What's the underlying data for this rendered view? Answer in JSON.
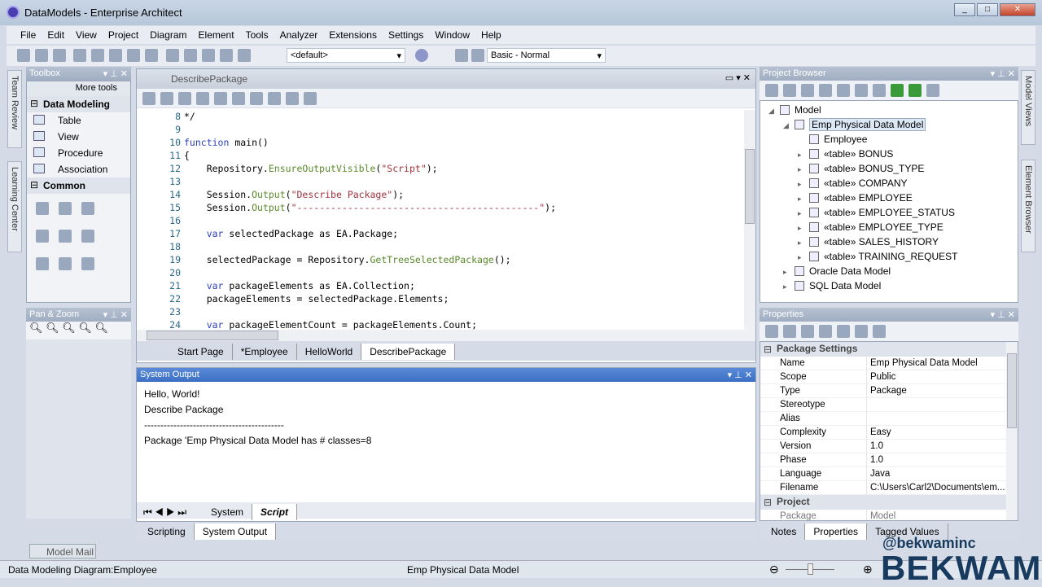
{
  "window": {
    "title": "DataModels - Enterprise Architect",
    "controls": [
      "_",
      "□",
      "✕"
    ]
  },
  "menu": [
    "File",
    "Edit",
    "View",
    "Project",
    "Diagram",
    "Element",
    "Tools",
    "Analyzer",
    "Extensions",
    "Settings",
    "Window",
    "Help"
  ],
  "toolbar": {
    "perspective": "<default>",
    "workspace": "Basic - Normal"
  },
  "side_tabs_left": [
    "Team Review",
    "Learning Center"
  ],
  "side_tabs_right": [
    "Model Views",
    "Element Browser"
  ],
  "toolbox": {
    "title": "Toolbox",
    "more_tools": "More tools",
    "groups": [
      {
        "name": "Data Modeling",
        "items": [
          "Table",
          "View",
          "Procedure",
          "Association"
        ]
      },
      {
        "name": "Common"
      }
    ]
  },
  "pan_zoom": {
    "title": "Pan & Zoom"
  },
  "editor": {
    "doc_title": "DescribePackage",
    "lines": [
      {
        "n": "8",
        "parts": [
          [
            "",
            "*/"
          ]
        ]
      },
      {
        "n": "9",
        "parts": []
      },
      {
        "n": "10",
        "parts": [
          [
            "kw",
            "function"
          ],
          [
            "",
            " main()"
          ]
        ]
      },
      {
        "n": "11",
        "parts": [
          [
            "",
            "{"
          ]
        ]
      },
      {
        "n": "12",
        "parts": [
          [
            "",
            "    Repository."
          ],
          [
            "fn",
            "EnsureOutputVisible"
          ],
          [
            "",
            "("
          ],
          [
            "st",
            "\"Script\""
          ],
          [
            "",
            ");"
          ]
        ]
      },
      {
        "n": "13",
        "parts": []
      },
      {
        "n": "14",
        "parts": [
          [
            "",
            "    Session."
          ],
          [
            "fn",
            "Output"
          ],
          [
            "",
            "("
          ],
          [
            "st",
            "\"Describe Package\""
          ],
          [
            "",
            ");"
          ]
        ]
      },
      {
        "n": "15",
        "parts": [
          [
            "",
            "    Session."
          ],
          [
            "fn",
            "Output"
          ],
          [
            "",
            "("
          ],
          [
            "st",
            "\"-------------------------------------------\""
          ],
          [
            "",
            ");"
          ]
        ]
      },
      {
        "n": "16",
        "parts": []
      },
      {
        "n": "17",
        "parts": [
          [
            "kw",
            "    var"
          ],
          [
            "",
            " selectedPackage as EA.Package;"
          ]
        ]
      },
      {
        "n": "18",
        "parts": []
      },
      {
        "n": "19",
        "parts": [
          [
            "",
            "    selectedPackage = Repository."
          ],
          [
            "fn",
            "GetTreeSelectedPackage"
          ],
          [
            "",
            "();"
          ]
        ]
      },
      {
        "n": "20",
        "parts": []
      },
      {
        "n": "21",
        "parts": [
          [
            "kw",
            "    var"
          ],
          [
            "",
            " packageElements as EA.Collection;"
          ]
        ]
      },
      {
        "n": "22",
        "parts": [
          [
            "",
            "    packageElements = selectedPackage.Elements;"
          ]
        ]
      },
      {
        "n": "23",
        "parts": []
      },
      {
        "n": "24",
        "parts": [
          [
            "kw",
            "    var"
          ],
          [
            "",
            " packageElementCount = packageElements.Count;"
          ]
        ]
      }
    ],
    "tabs": [
      "Start Page",
      "*Employee",
      "HelloWorld",
      "DescribePackage"
    ],
    "active_tab": "DescribePackage"
  },
  "output": {
    "title": "System Output",
    "lines": [
      "Hello, World!",
      "Describe Package",
      "-------------------------------------------",
      "Package 'Emp Physical Data Model has # classes=8"
    ],
    "tabs": [
      "System",
      "Script"
    ],
    "active_tab": "Script",
    "bottom_tabs": [
      "Scripting",
      "System Output"
    ]
  },
  "browser": {
    "title": "Project Browser",
    "root": "Model",
    "package": "Emp Physical Data Model",
    "diagram": "Employee",
    "tables": [
      "«table» BONUS",
      "«table» BONUS_TYPE",
      "«table» COMPANY",
      "«table» EMPLOYEE",
      "«table» EMPLOYEE_STATUS",
      "«table» EMPLOYEE_TYPE",
      "«table» SALES_HISTORY",
      "«table» TRAINING_REQUEST"
    ],
    "other_packages": [
      "Oracle Data Model",
      "SQL Data Model"
    ]
  },
  "properties": {
    "title": "Properties",
    "section1": "Package Settings",
    "rows": [
      [
        "Name",
        "Emp Physical Data Model"
      ],
      [
        "Scope",
        "Public"
      ],
      [
        "Type",
        "Package"
      ],
      [
        "Stereotype",
        ""
      ],
      [
        "Alias",
        ""
      ],
      [
        "Complexity",
        "Easy"
      ],
      [
        "Version",
        "1.0"
      ],
      [
        "Phase",
        "1.0"
      ],
      [
        "Language",
        "Java"
      ],
      [
        "Filename",
        "C:\\Users\\Carl2\\Documents\\em..."
      ]
    ],
    "section2": "Project",
    "row_partial": [
      "Package",
      "Model"
    ],
    "tabs": [
      "Notes",
      "Properties",
      "Tagged Values"
    ],
    "active_tab": "Properties"
  },
  "model_mail": "Model Mail",
  "status": {
    "left": "Data Modeling Diagram:Employee",
    "center": "Emp Physical Data Model"
  },
  "watermark": {
    "handle": "@bekwaminc",
    "logo": "BEKWAM"
  }
}
